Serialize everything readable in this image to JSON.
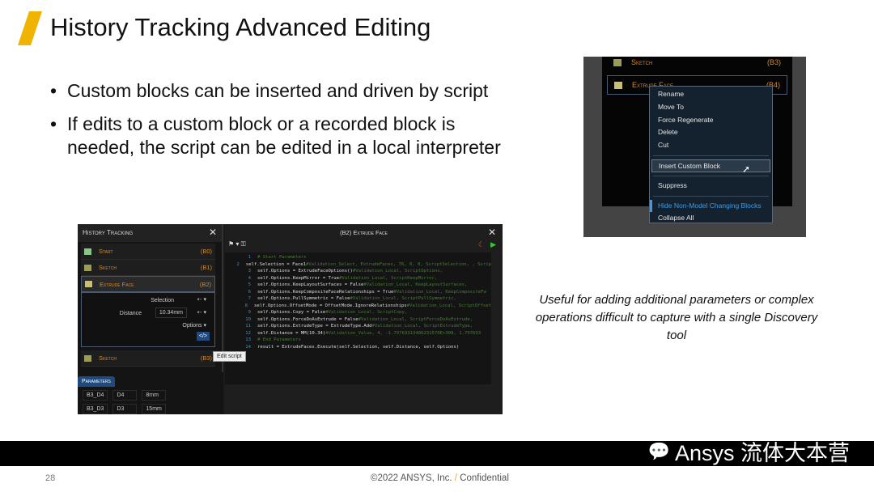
{
  "slide": {
    "title": "History Tracking Advanced Editing",
    "bullets": [
      "Custom blocks can be inserted and driven by script",
      "If edits to a custom block or a recorded block is needed, the script can be edited in a local interpreter"
    ],
    "caption": "Useful for adding additional parameters or complex operations difficult to capture with a single Discovery tool",
    "page_number": "28",
    "footer_copyright": "©2022 ANSYS, Inc.",
    "footer_sep": "/",
    "footer_confidential": "Confidential",
    "watermark": "Ansys 流体大本营",
    "accent": "#f0b400"
  },
  "history": {
    "title": "History Tracking",
    "rows": [
      {
        "label": "Start",
        "id": "(B0)"
      },
      {
        "label": "Sketch",
        "id": "(B1)"
      },
      {
        "label": "Extrude Face",
        "id": "(B2)"
      },
      {
        "label": "Sketch",
        "id": "(B3)"
      }
    ],
    "selection_label": "Selection",
    "distance_label": "Distance",
    "distance_value": "10.34mm",
    "options_label": "Options",
    "edit_script_icon": "</>",
    "tooltip": "Edit script",
    "params_tab": "Parameters",
    "params": [
      [
        "B3_D4",
        "D4",
        "8mm"
      ],
      [
        "B3_D3",
        "D3",
        "15mm"
      ]
    ]
  },
  "script": {
    "title": "(B2)  Extrude Face",
    "lines": [
      {
        "n": "1",
        "code": "",
        "comment": "# Start Parameters"
      },
      {
        "n": "2",
        "code": "self.Selection = Face1 ",
        "comment": "#Validation_Select, ExtrudeFaces, 76, 0, 0, ScriptSelection, , Scrip"
      },
      {
        "n": "3",
        "code": "self.Options = ExtrudeFaceOptions() ",
        "comment": "#Validation_Local, ScriptOptions,"
      },
      {
        "n": "4",
        "code": "self.Options.KeepMirror = True ",
        "comment": "#Validation_Local, ScriptKeepMirror,"
      },
      {
        "n": "5",
        "code": "self.Options.KeepLayoutSurfaces = False ",
        "comment": "#Validation_Local, KeepLayoutSurfaces,"
      },
      {
        "n": "6",
        "code": "self.Options.KeepCompositeFaceRelationships = True ",
        "comment": "#Validation_Local, KeepCompositeFa"
      },
      {
        "n": "7",
        "code": "self.Options.PullSymmetric = False ",
        "comment": "#Validation_Local, ScriptPullSymmetric,"
      },
      {
        "n": "8",
        "code": "self.Options.OffsetMode = OffsetMode.IgnoreRelationships ",
        "comment": "#Validation_Local, ScriptOffset"
      },
      {
        "n": "9",
        "code": "self.Options.Copy = False ",
        "comment": "#Validation_Local, ScriptCopy,"
      },
      {
        "n": "10",
        "code": "self.Options.ForceDoAsExtrude = False ",
        "comment": "#Validation_Local, ScriptForceDoAsExtrude,"
      },
      {
        "n": "11",
        "code": "self.Options.ExtrudeType = ExtrudeType.Add ",
        "comment": "#Validation_Local, ScriptExtrudeType,"
      },
      {
        "n": "12",
        "code": "self.Distance = MM(10.34) ",
        "comment": "#Validation_Value, 4, -1.79769313486231570E+308, 1.797693"
      },
      {
        "n": "13",
        "code": "",
        "comment": "# End Parameters"
      },
      {
        "n": "14",
        "code": "result = ExtrudeFaces.Execute(self.Selection, self.Distance, self.Options)",
        "comment": ""
      }
    ]
  },
  "context": {
    "rows": [
      {
        "label": "Sketch",
        "id": "(B3)"
      },
      {
        "label": "Extrude Face",
        "id": "(B4)"
      }
    ],
    "menu": [
      "Rename",
      "Move To",
      "Force Regenerate",
      "Delete",
      "Cut",
      "Insert Custom Block",
      "Suppress",
      "Hide Non-Model Changing Blocks",
      "Collapse All"
    ]
  }
}
